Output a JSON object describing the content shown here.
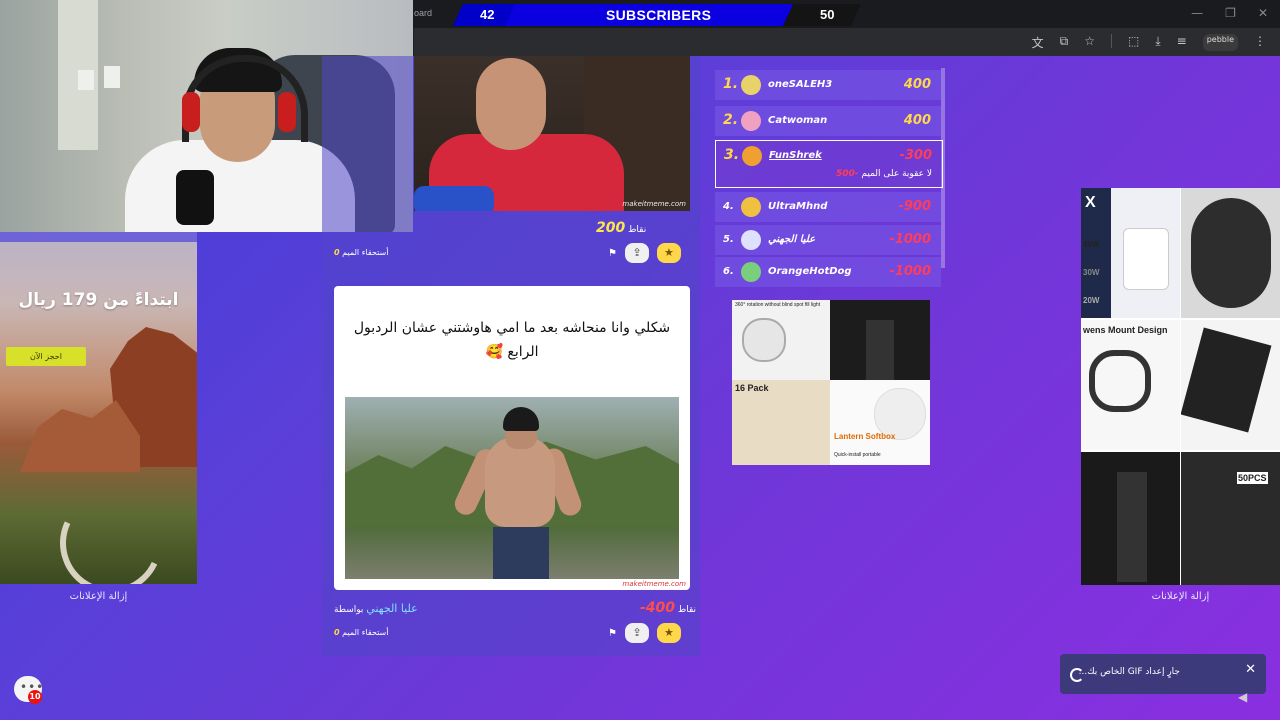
{
  "browser": {
    "tab_text": "oard",
    "window_buttons": [
      "—",
      "❐",
      "✕"
    ],
    "toolbar_icons": [
      "translate-icon",
      "screenshot-icon",
      "star-icon",
      "extensions-icon",
      "download-icon",
      "media-icon",
      "profile-icon",
      "menu-icon"
    ],
    "profile_label": "pebble"
  },
  "subscribers": {
    "left": "42",
    "label": "SUBSCRIBERS",
    "right": "50"
  },
  "left_ad": {
    "headline": "ابتداءً من 179 ريال",
    "cta": "احجز الآن",
    "remove": "إزالة الإعلانات"
  },
  "right_ad": {
    "remove": "إزالة الإعلانات",
    "texts": [
      "40W",
      "30W",
      "20W",
      "wens Mount Design",
      "50PCS"
    ]
  },
  "product_ad": {
    "texts": [
      "360° rotation without blind spot fill light",
      "16 Pack",
      "Lantern Softbox",
      "Quick-install portable"
    ]
  },
  "post1": {
    "points_label": "نقاط",
    "points": "200",
    "meme_worth_label": "أستحقاء الميم",
    "meme_worth": "0",
    "watermark": "makeitmeme.com"
  },
  "post2": {
    "caption": "شكلي وانا منحاشه بعد ما امي هاوشتني عشان الردبول الرابع 🥰",
    "watermark": "makeitmeme.com",
    "points_label": "نقاط",
    "points": "-400",
    "by_label": "بواسطة",
    "author": "عليا الجهني",
    "meme_worth_label": "أستحقاء الميم",
    "meme_worth": "0"
  },
  "leaderboard": [
    {
      "rank": "1.",
      "name": "oneSALEH3",
      "score": "400"
    },
    {
      "rank": "2.",
      "name": "Catwoman",
      "score": "400"
    },
    {
      "rank": "3.",
      "name": "FunShrek",
      "score": "-300",
      "penalty_text": "لا عقوبة على الميم",
      "penalty": "-500"
    },
    {
      "rank": "4.",
      "name": "UltraMhnd",
      "score": "-900"
    },
    {
      "rank": "5.",
      "name": "عليا الجهني",
      "score": "-1000"
    },
    {
      "rank": "6.",
      "name": "OrangeHotDog",
      "score": "-1000"
    }
  ],
  "toast": {
    "message": "جارٍ إعداد GIF الخاص بك...",
    "close": "✕"
  },
  "chat": {
    "badge": "10"
  },
  "colors": {
    "accent": "#ffd84a",
    "negative": "#ff3d5a",
    "subs_blue": "#0a00e0"
  }
}
